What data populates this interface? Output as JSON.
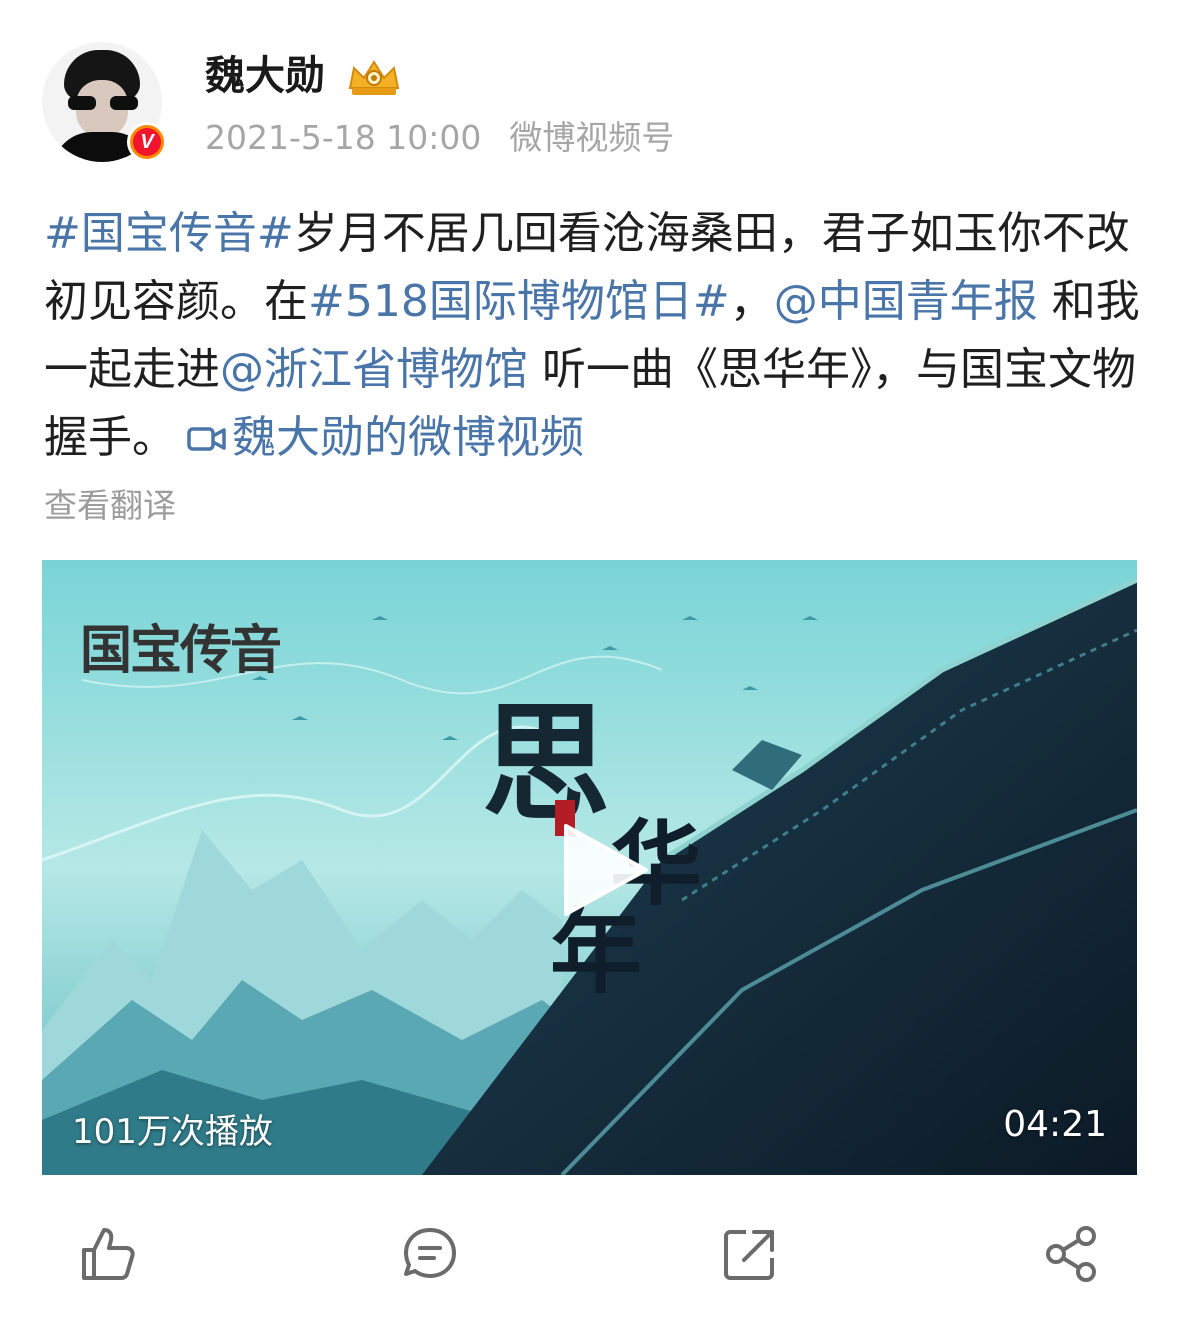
{
  "header": {
    "user_name": "魏大勋",
    "timestamp": "2021-5-18 10:00",
    "source": "微博视频号",
    "verified_badge": "V",
    "crown_icon": "vip-crown-icon"
  },
  "post": {
    "seg1": "#国宝传音#",
    "seg2": "岁月不居几回看沧海桑田，君子如玉你不改初见容颜。在",
    "seg3": "#518国际博物馆日#",
    "seg4": "，",
    "seg5": "@中国青年报",
    "seg6": " 和我一起走进",
    "seg7": "@浙江省博物馆",
    "seg8": " 听一曲《思华年》，与国宝文物握手。",
    "seg9": "魏大勋的微博视频",
    "translate": "查看翻译"
  },
  "video": {
    "logo": "国宝传音",
    "title_chars": [
      "思",
      "华",
      "年"
    ],
    "play_count": "101万次播放",
    "duration": "04:21"
  },
  "actions": [
    "thumbs-up-icon",
    "comment-icon",
    "repost-icon",
    "share-icon"
  ],
  "colors": {
    "link": "#4a75a8",
    "meta": "#a6a6a6",
    "icon": "#6b6b6b"
  }
}
